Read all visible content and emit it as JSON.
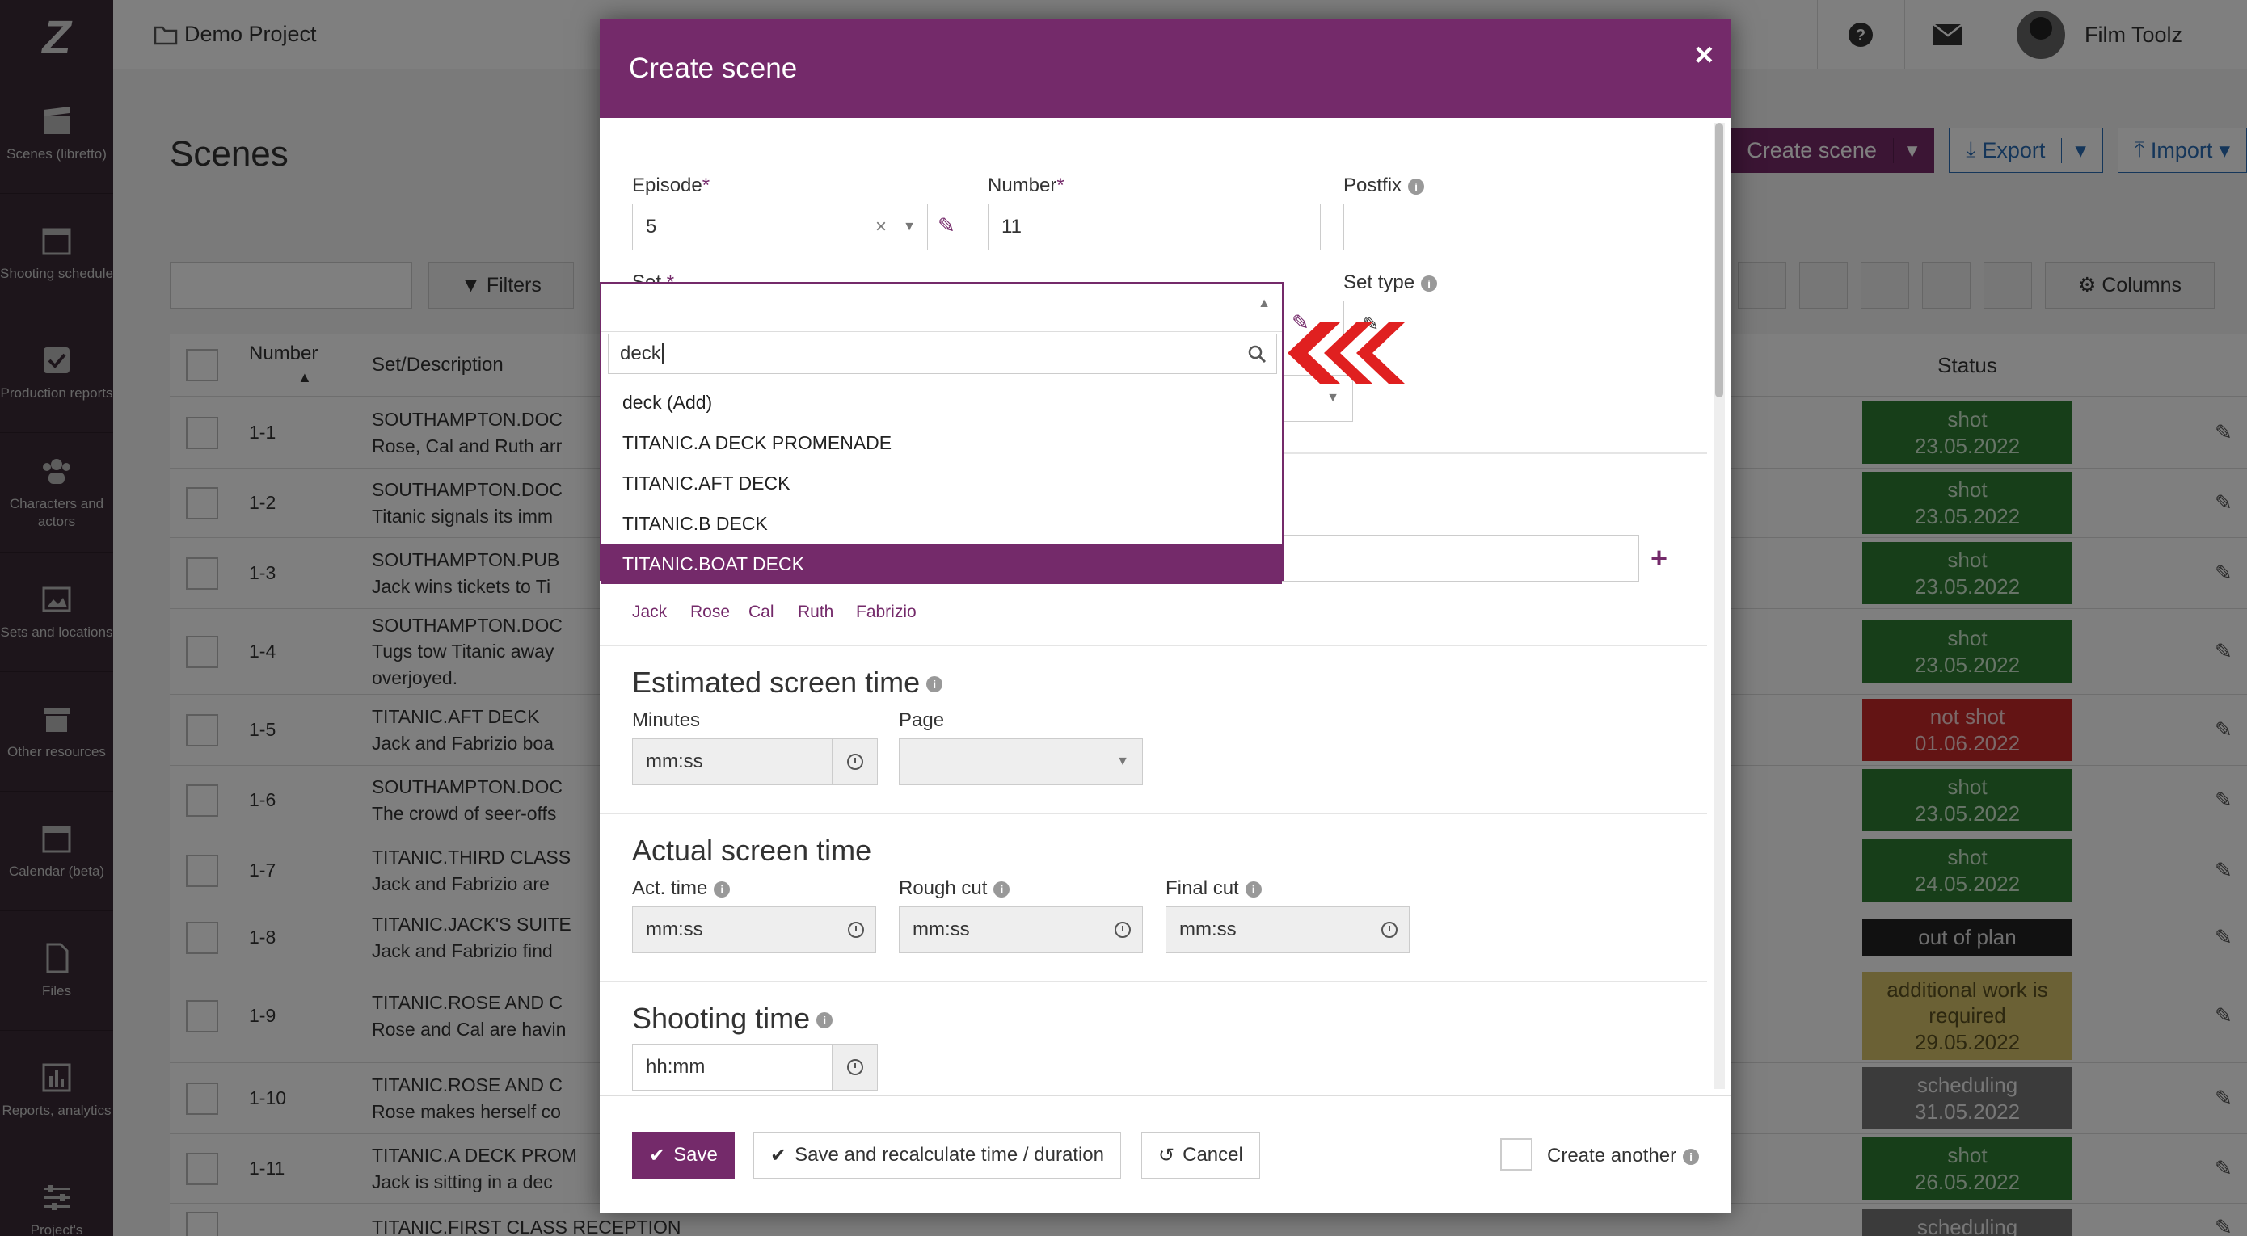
{
  "sidebar": {
    "logo": "Z",
    "items": [
      {
        "label": "Scenes (libretto)",
        "icon": "clapper-icon"
      },
      {
        "label": "Shooting schedule",
        "icon": "calendar-icon"
      },
      {
        "label": "Production reports",
        "icon": "checkbox-icon"
      },
      {
        "label": "Characters and actors",
        "icon": "people-icon"
      },
      {
        "label": "Sets and locations",
        "icon": "image-icon"
      },
      {
        "label": "Other resources",
        "icon": "archive-icon"
      },
      {
        "label": "Calendar (beta)",
        "icon": "calendar-icon"
      },
      {
        "label": "Files",
        "icon": "file-icon"
      },
      {
        "label": "Reports, analytics",
        "icon": "bar-chart-icon"
      },
      {
        "label": "Project's",
        "icon": "sliders-icon"
      }
    ]
  },
  "topbar": {
    "project": "Demo Project",
    "user": "Film Toolz"
  },
  "page": {
    "title": "Scenes",
    "create_button": "Create scene",
    "export_button": "Export",
    "import_button": "Import",
    "filters_button": "Filters",
    "columns_button": "Columns",
    "headers": {
      "number": "Number",
      "set": "Set/Description",
      "status": "Status"
    },
    "rows": [
      {
        "num": "1-1",
        "set": "SOUTHAMPTON.DOC",
        "desc": "Rose, Cal and Ruth arr",
        "status": [
          "shot",
          "23.05.2022"
        ],
        "cls": "st-shot"
      },
      {
        "num": "1-2",
        "set": "SOUTHAMPTON.DOC",
        "desc": "Titanic signals its imm",
        "status": [
          "shot",
          "23.05.2022"
        ],
        "cls": "st-shot"
      },
      {
        "num": "1-3",
        "set": "SOUTHAMPTON.PUB",
        "desc": "Jack wins tickets to Ti",
        "status": [
          "shot",
          "23.05.2022"
        ],
        "cls": "st-shot"
      },
      {
        "num": "1-4",
        "set": "SOUTHAMPTON.DOC",
        "desc": "Tugs tow Titanic away",
        "desc2": "overjoyed.",
        "status": [
          "shot",
          "23.05.2022"
        ],
        "cls": "st-shot"
      },
      {
        "num": "1-5",
        "set": "TITANIC.AFT DECK",
        "desc": "Jack and Fabrizio boa",
        "status": [
          "not shot",
          "01.06.2022"
        ],
        "cls": "st-not"
      },
      {
        "num": "1-6",
        "set": "SOUTHAMPTON.DOC",
        "desc": "The crowd of seer-offs",
        "status": [
          "shot",
          "23.05.2022"
        ],
        "cls": "st-shot"
      },
      {
        "num": "1-7",
        "set": "TITANIC.THIRD CLASS",
        "desc": "Jack and Fabrizio are",
        "status": [
          "shot",
          "24.05.2022"
        ],
        "cls": "st-shot"
      },
      {
        "num": "1-8",
        "set": "TITANIC.JACK'S SUITE",
        "desc": "Jack and Fabrizio find",
        "status": [
          "out of plan",
          ""
        ],
        "cls": "st-out"
      },
      {
        "num": "1-9",
        "set": "TITANIC.ROSE AND C",
        "desc": "Rose and Cal are havin",
        "status": [
          "additional work is required",
          "29.05.2022"
        ],
        "cls": "st-add"
      },
      {
        "num": "1-10",
        "set": "TITANIC.ROSE AND C",
        "desc": "Rose makes herself co",
        "status": [
          "scheduling",
          "31.05.2022"
        ],
        "cls": "st-sch"
      },
      {
        "num": "1-11",
        "set": "TITANIC.A DECK PROM",
        "desc": "Jack is sitting in a dec",
        "status": [
          "shot",
          "26.05.2022"
        ],
        "cls": "st-shot"
      },
      {
        "num": "",
        "set": "TITANIC.FIRST CLASS RECEPTION",
        "desc": "",
        "status": [
          "scheduling",
          ""
        ],
        "cls": "st-sch"
      }
    ]
  },
  "modal": {
    "title": "Create scene",
    "episode_label": "Episode",
    "episode_value": "5",
    "number_label": "Number",
    "number_value": "11",
    "postfix_label": "Postfix",
    "postfix_value": "",
    "set_label": "Set",
    "set_type_label": "Set type",
    "characters": [
      "Jack",
      "Rose",
      "Cal",
      "Ruth",
      "Fabrizio"
    ],
    "estimated_title": "Estimated screen time",
    "minutes_label": "Minutes",
    "minutes_placeholder": "mm:ss",
    "page_label": "Page",
    "actual_title": "Actual screen time",
    "act_time_label": "Act. time",
    "rough_cut_label": "Rough cut",
    "final_cut_label": "Final cut",
    "act_placeholder": "mm:ss",
    "rough_placeholder": "mm:ss",
    "final_placeholder": "mm:ss",
    "shooting_title": "Shooting time",
    "shooting_placeholder": "hh:mm",
    "save_button": "Save",
    "save_recalc_button": "Save and recalculate time / duration",
    "cancel_button": "Cancel",
    "create_another_label": "Create another"
  },
  "dropdown": {
    "search_value": "deck",
    "options": [
      "deck (Add)",
      "TITANIC.A DECK PROMENADE",
      "TITANIC.AFT DECK",
      "TITANIC.B DECK",
      "TITANIC.BOAT DECK"
    ],
    "active_index": 4
  },
  "colors": {
    "accent": "#742a6a",
    "sidebar": "#3a2a36",
    "link": "#2a6db5",
    "arrow": "#e02020"
  }
}
